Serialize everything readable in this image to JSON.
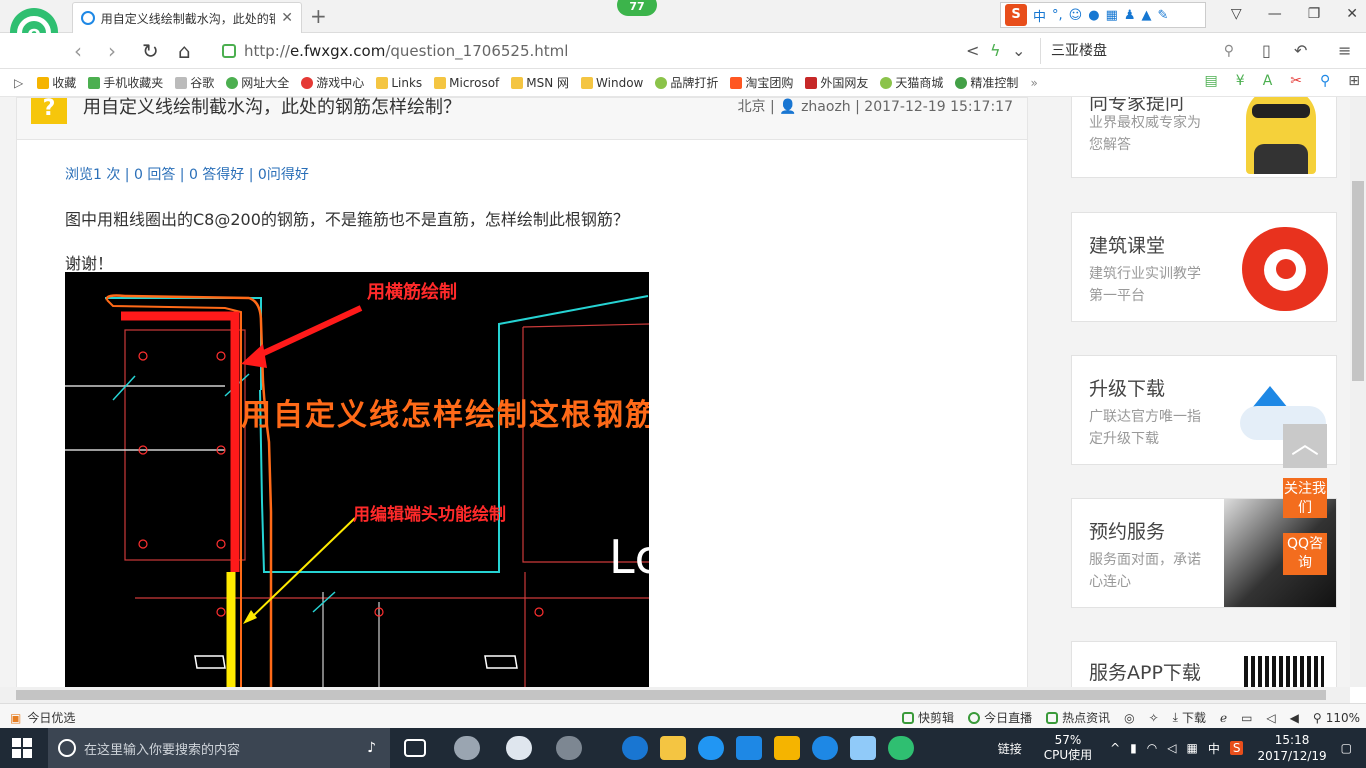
{
  "browser": {
    "tab_title": "用自定义线绘制截水沟，此处的钢筋怎样绘制？",
    "badge_count": "77",
    "url_scheme": "http://",
    "url_host": "e.fwxgx.com",
    "url_path": "/question_1706525.html",
    "search_text": "三亚楼盘",
    "sogou_chars": [
      "中",
      "°,",
      "☺"
    ]
  },
  "bookmarks": [
    {
      "label": "收藏",
      "icon": "star-icon"
    },
    {
      "label": "手机收藏夹",
      "icon": "phone-icon"
    },
    {
      "label": "谷歌",
      "icon": "doc-icon"
    },
    {
      "label": "网址大全",
      "icon": "globe-icon"
    },
    {
      "label": "游戏中心",
      "icon": "game-icon"
    },
    {
      "label": "Links",
      "icon": "folder-icon"
    },
    {
      "label": "Microsof",
      "icon": "folder-icon"
    },
    {
      "label": "MSN 网",
      "icon": "folder-icon"
    },
    {
      "label": "Window",
      "icon": "folder-icon"
    },
    {
      "label": "品牌打折",
      "icon": "leaf-icon"
    },
    {
      "label": "淘宝团购",
      "icon": "tao-icon"
    },
    {
      "label": "外国网友",
      "icon": "flag-icon"
    },
    {
      "label": "天猫商城",
      "icon": "leaf-icon"
    },
    {
      "label": "精准控制",
      "icon": "chat-icon"
    }
  ],
  "question": {
    "title": "用自定义线绘制截水沟，此处的钢筋怎样绘制？",
    "location": "北京",
    "author": "zhaozh",
    "datetime": "2017-12-19 15:17:17",
    "stats": "浏览1 次 | 0 回答 | 0 答得好 | 0问得好",
    "body": "图中用粗线圈出的C8@200的钢筋，不是箍筋也不是直筋，怎样绘制此根钢筋？",
    "thanks": "谢谢！",
    "image_labels": {
      "top": "用横筋绘制",
      "middle": "用自定义线怎样绘制这根钢筋",
      "bottom": "用编辑端头功能绘制",
      "corner": "Lc"
    }
  },
  "sidebar": {
    "cards": [
      {
        "title": "向专家提问",
        "desc": "业界最权威专家为您解答"
      },
      {
        "title": "建筑课堂",
        "desc": "建筑行业实训教学第一平台"
      },
      {
        "title": "升级下载",
        "desc": "广联达官方唯一指定升级下载"
      },
      {
        "title": "预约服务",
        "desc": "服务面对面，承诺心连心"
      },
      {
        "title": "服务APP下载",
        "desc": ""
      }
    ],
    "follow_label": "关注我们",
    "qq_label": "QQ咨询",
    "totop_label": "︿"
  },
  "statusbar": {
    "left": "今日优选",
    "items": [
      "快剪辑",
      "今日直播",
      "热点资讯"
    ],
    "download": "下载",
    "zoom": "110%"
  },
  "taskbar": {
    "search_placeholder": "在这里输入你要搜索的内容",
    "link_label": "链接",
    "cpu_percent": "57%",
    "cpu_label": "CPU使用",
    "ime": "中",
    "time": "15:18",
    "date": "2017/12/19"
  }
}
